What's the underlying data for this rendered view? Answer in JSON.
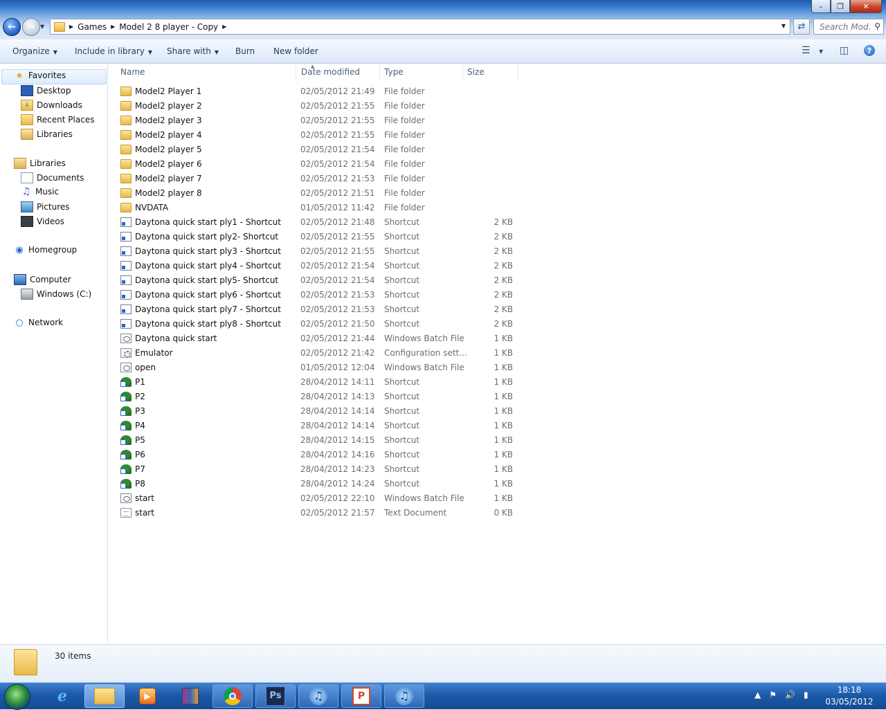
{
  "window": {
    "breadcrumb": [
      "Games",
      "Model 2 8 player - Copy"
    ],
    "search_placeholder": "Search Mod..."
  },
  "toolbar": {
    "organize": "Organize",
    "include_in_library": "Include in library",
    "share_with": "Share with",
    "burn": "Burn",
    "new_folder": "New folder"
  },
  "nav": {
    "favorites": "Favorites",
    "favorites_items": [
      "Desktop",
      "Downloads",
      "Recent Places",
      "Libraries"
    ],
    "libraries": "Libraries",
    "libraries_items": [
      "Documents",
      "Music",
      "Pictures",
      "Videos"
    ],
    "homegroup": "Homegroup",
    "computer": "Computer",
    "computer_items": [
      "Windows (C:)"
    ],
    "network": "Network"
  },
  "columns": {
    "name": "Name",
    "date": "Date modified",
    "type": "Type",
    "size": "Size"
  },
  "files": [
    {
      "name": "Model2 Player 1",
      "date": "02/05/2012 21:49",
      "type": "File folder",
      "size": "",
      "icon": "folder-icon"
    },
    {
      "name": "Model2 player 2",
      "date": "02/05/2012 21:55",
      "type": "File folder",
      "size": "",
      "icon": "folder-icon"
    },
    {
      "name": "Model2 player 3",
      "date": "02/05/2012 21:55",
      "type": "File folder",
      "size": "",
      "icon": "folder-icon"
    },
    {
      "name": "Model2 player 4",
      "date": "02/05/2012 21:55",
      "type": "File folder",
      "size": "",
      "icon": "folder-icon"
    },
    {
      "name": "Model2 player 5",
      "date": "02/05/2012 21:54",
      "type": "File folder",
      "size": "",
      "icon": "folder-icon"
    },
    {
      "name": "Model2 player 6",
      "date": "02/05/2012 21:54",
      "type": "File folder",
      "size": "",
      "icon": "folder-icon"
    },
    {
      "name": "Model2 player 7",
      "date": "02/05/2012 21:53",
      "type": "File folder",
      "size": "",
      "icon": "folder-icon"
    },
    {
      "name": "Model2 player 8",
      "date": "02/05/2012 21:51",
      "type": "File folder",
      "size": "",
      "icon": "folder-icon"
    },
    {
      "name": "NVDATA",
      "date": "01/05/2012 11:42",
      "type": "File folder",
      "size": "",
      "icon": "folder-icon"
    },
    {
      "name": "Daytona quick start ply1 - Shortcut",
      "date": "02/05/2012 21:48",
      "type": "Shortcut",
      "size": "2 KB",
      "icon": "shortcut-icon"
    },
    {
      "name": "Daytona quick start ply2- Shortcut",
      "date": "02/05/2012 21:55",
      "type": "Shortcut",
      "size": "2 KB",
      "icon": "shortcut-icon"
    },
    {
      "name": "Daytona quick start ply3 - Shortcut",
      "date": "02/05/2012 21:55",
      "type": "Shortcut",
      "size": "2 KB",
      "icon": "shortcut-icon"
    },
    {
      "name": "Daytona quick start ply4 - Shortcut",
      "date": "02/05/2012 21:54",
      "type": "Shortcut",
      "size": "2 KB",
      "icon": "shortcut-icon"
    },
    {
      "name": "Daytona quick start ply5- Shortcut",
      "date": "02/05/2012 21:54",
      "type": "Shortcut",
      "size": "2 KB",
      "icon": "shortcut-icon"
    },
    {
      "name": "Daytona quick start ply6 - Shortcut",
      "date": "02/05/2012 21:53",
      "type": "Shortcut",
      "size": "2 KB",
      "icon": "shortcut-icon"
    },
    {
      "name": "Daytona quick start ply7 - Shortcut",
      "date": "02/05/2012 21:53",
      "type": "Shortcut",
      "size": "2 KB",
      "icon": "shortcut-icon"
    },
    {
      "name": "Daytona quick start ply8 - Shortcut",
      "date": "02/05/2012 21:50",
      "type": "Shortcut",
      "size": "2 KB",
      "icon": "shortcut-icon"
    },
    {
      "name": "Daytona quick start",
      "date": "02/05/2012 21:44",
      "type": "Windows Batch File",
      "size": "1 KB",
      "icon": "batch-file-icon"
    },
    {
      "name": "Emulator",
      "date": "02/05/2012 21:42",
      "type": "Configuration sett...",
      "size": "1 KB",
      "icon": "config-file-icon"
    },
    {
      "name": "open",
      "date": "01/05/2012 12:04",
      "type": "Windows Batch File",
      "size": "1 KB",
      "icon": "batch-file-icon"
    },
    {
      "name": "P1",
      "date": "28/04/2012 14:11",
      "type": "Shortcut",
      "size": "1 KB",
      "icon": "game-shortcut-icon"
    },
    {
      "name": "P2",
      "date": "28/04/2012 14:13",
      "type": "Shortcut",
      "size": "1 KB",
      "icon": "game-shortcut-icon"
    },
    {
      "name": "P3",
      "date": "28/04/2012 14:14",
      "type": "Shortcut",
      "size": "1 KB",
      "icon": "game-shortcut-icon"
    },
    {
      "name": "P4",
      "date": "28/04/2012 14:14",
      "type": "Shortcut",
      "size": "1 KB",
      "icon": "game-shortcut-icon"
    },
    {
      "name": "P5",
      "date": "28/04/2012 14:15",
      "type": "Shortcut",
      "size": "1 KB",
      "icon": "game-shortcut-icon"
    },
    {
      "name": "P6",
      "date": "28/04/2012 14:16",
      "type": "Shortcut",
      "size": "1 KB",
      "icon": "game-shortcut-icon"
    },
    {
      "name": "P7",
      "date": "28/04/2012 14:23",
      "type": "Shortcut",
      "size": "1 KB",
      "icon": "game-shortcut-icon"
    },
    {
      "name": "P8",
      "date": "28/04/2012 14:24",
      "type": "Shortcut",
      "size": "1 KB",
      "icon": "game-shortcut-icon"
    },
    {
      "name": "start",
      "date": "02/05/2012 22:10",
      "type": "Windows Batch File",
      "size": "1 KB",
      "icon": "batch-file-icon"
    },
    {
      "name": "start",
      "date": "02/05/2012 21:57",
      "type": "Text Document",
      "size": "0 KB",
      "icon": "text-file-icon"
    }
  ],
  "status": {
    "item_count": "30 items"
  },
  "taskbar": {
    "apps": [
      "internet-explorer-icon",
      "explorer-icon",
      "media-player-icon",
      "winrar-icon",
      "chrome-icon",
      "photoshop-icon",
      "itunes-icon",
      "powerpoint-icon",
      "itunes-icon"
    ],
    "photoshop_label": "Ps",
    "time": "18:18",
    "date": "03/05/2012"
  },
  "colors": {
    "accent": "#1b5aa9",
    "folder": "#e8b84a"
  }
}
